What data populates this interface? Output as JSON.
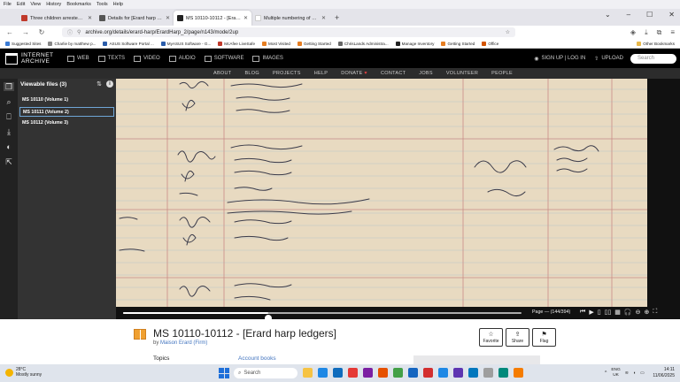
{
  "menubar": [
    "File",
    "Edit",
    "View",
    "History",
    "Bookmarks",
    "Tools",
    "Help"
  ],
  "tabs": [
    {
      "label": "Three children arrested on susp",
      "color": "#c0392b",
      "active": false
    },
    {
      "label": "Details for [Erard harp ledgers]",
      "color": "#555555",
      "active": false
    },
    {
      "label": "MS 10110-10112 - [Erard harp l",
      "color": "#222222",
      "active": true
    },
    {
      "label": "Multiple numbering of Sebastiá",
      "color": "#ffffff",
      "active": false
    }
  ],
  "url": {
    "text": "archive.org/details/erard-harp/ErardHarp_2/page/n143/mode/2up"
  },
  "bookmarks": [
    {
      "label": "Suggested Sites",
      "color": "#3a7bd5"
    },
    {
      "label": "Charlie by matthew p...",
      "color": "#888888"
    },
    {
      "label": "ASUS Software Portal ...",
      "color": "#2a5caa"
    },
    {
      "label": "MyASUS Software - G...",
      "color": "#2a5caa"
    },
    {
      "label": "McAfee LiveSafe",
      "color": "#c0392b"
    },
    {
      "label": "Most Visited",
      "color": "#e67e22"
    },
    {
      "label": "Getting Started",
      "color": "#e67e22"
    },
    {
      "label": "ChrisLands Administra...",
      "color": "#666666"
    },
    {
      "label": "Manage Inventory",
      "color": "#222222"
    },
    {
      "label": "Getting Started",
      "color": "#e67e22"
    },
    {
      "label": "Office",
      "color": "#d35400"
    }
  ],
  "other_bookmarks": "Other Bookmarks",
  "ia": {
    "logo_line1": "INTERNET",
    "logo_line2": "ARCHIVE",
    "media_types": [
      "WEB",
      "TEXTS",
      "VIDEO",
      "AUDIO",
      "SOFTWARE",
      "IMAGES"
    ],
    "signup": "SIGN UP | LOG IN",
    "upload": "UPLOAD",
    "search_placeholder": "Search",
    "subnav": [
      "ABOUT",
      "BLOG",
      "PROJECTS",
      "HELP",
      "DONATE",
      "CONTACT",
      "JOBS",
      "VOLUNTEER",
      "PEOPLE"
    ]
  },
  "side_panel": {
    "title": "Viewable files (3)",
    "volumes": [
      "MS 10110 (Volume 1)",
      "MS 10111 (Volume 2)",
      "MS 10112 (Volume 3)"
    ],
    "selected_index": 1
  },
  "viewer": {
    "page_label": "Page — (144/394)",
    "progress": 0.365
  },
  "item": {
    "title": "MS 10110-10112 - [Erard harp ledgers]",
    "by_prefix": "by",
    "author": "Maison Erard (Firm)",
    "actions": [
      {
        "label": "Favorite",
        "icon": "☆"
      },
      {
        "label": "Share",
        "icon": "⇪"
      },
      {
        "label": "Flag",
        "icon": "⚑"
      }
    ],
    "topics_label": "Topics",
    "topic_link": "Account books"
  },
  "taskbar": {
    "temp": "28°C",
    "weather": "Mostly sunny",
    "search_placeholder": "Search",
    "lang1": "ENG",
    "lang2": "UK",
    "time": "14:11",
    "date": "11/06/2025",
    "app_colors": [
      "#f6c343",
      "#1e88e5",
      "#0f6cbd",
      "#e53935",
      "#7b1fa2",
      "#e65100",
      "#43a047",
      "#1565c0",
      "#d32f2f",
      "#1e88e5",
      "#5e35b1",
      "#0277bd",
      "#9e9e9e",
      "#00897b",
      "#f57c00"
    ]
  }
}
